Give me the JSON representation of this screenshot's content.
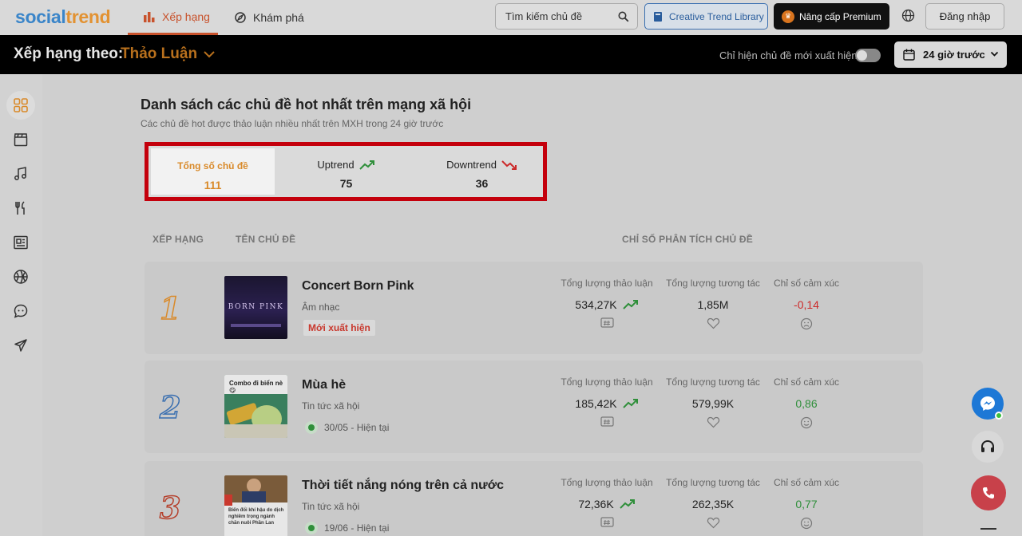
{
  "nav": {
    "logo_part1": "social",
    "logo_part2": "trend",
    "tab_ranking": "Xếp hạng",
    "tab_explore": "Khám phá",
    "search_placeholder": "Tìm kiếm chủ đề",
    "creative_library": "Creative Trend Library",
    "premium": "Nâng cấp Premium",
    "login": "Đăng nhập"
  },
  "rankbar": {
    "label": "Xếp hạng theo:",
    "value": "Thảo Luận",
    "new_only": "Chỉ hiện chủ đề mới xuất hiện",
    "time_range": "24 giờ trước"
  },
  "main": {
    "title": "Danh sách các chủ đề hot nhất trên mạng xã hội",
    "subtitle": "Các chủ đề hot được thảo luận nhiều nhất trên MXH trong 24 giờ trước"
  },
  "stats": {
    "total_label": "Tổng số chủ đề",
    "total_value": "111",
    "up_label": "Uptrend",
    "up_value": "75",
    "down_label": "Downtrend",
    "down_value": "36"
  },
  "table": {
    "col_rank": "XẾP HẠNG",
    "col_name": "TÊN CHỦ ĐỀ",
    "col_metrics": "CHỈ SỐ PHÂN TÍCH CHỦ ĐỀ"
  },
  "metric_labels": {
    "discussion": "Tổng lượng thảo luận",
    "interaction": "Tổng lượng tương tác",
    "sentiment": "Chỉ số cảm xúc"
  },
  "topics": [
    {
      "rank": "1",
      "name": "Concert Born Pink",
      "category": "Âm nhạc",
      "badge": "Mới xuất hiện",
      "discussion": "534,27K",
      "interaction": "1,85M",
      "sentiment": "-0,14",
      "rank_color": "#d98a2a",
      "thumb_text": "BORN PINK"
    },
    {
      "rank": "2",
      "name": "Mùa hè",
      "category": "Tin tức xã hội",
      "date": "30/05 - Hiện tại",
      "discussion": "185,42K",
      "interaction": "579,99K",
      "sentiment": "0,86",
      "rank_color": "#3a6fb0",
      "thumb_text": "Combo đi biển nè 😋"
    },
    {
      "rank": "3",
      "name": "Thời tiết nắng nóng trên cả nước",
      "category": "Tin tức xã hội",
      "date": "19/06 - Hiện tại",
      "discussion": "72,36K",
      "interaction": "262,35K",
      "sentiment": "0,77",
      "rank_color": "#b5402c",
      "thumb_text": "Biến đổi khí hậu do dịch nghiêm trọng ngành chăn nuôi Phần Lan"
    }
  ],
  "icons": {
    "nav_ranking": "bar-chart-icon",
    "nav_explore": "compass-icon",
    "search": "search-icon",
    "library": "book-icon",
    "premium": "crown-icon",
    "language": "globe-icon",
    "calendar": "calendar-icon",
    "sidebar": [
      "grid-icon",
      "clapperboard-icon",
      "music-icon",
      "food-icon",
      "news-icon",
      "sport-icon",
      "chat-icon",
      "plane-icon"
    ]
  },
  "colors": {
    "accent": "#c8522c",
    "highlight_border": "#c4000c",
    "up": "#2f8f3a",
    "down": "#cc2a2a"
  }
}
